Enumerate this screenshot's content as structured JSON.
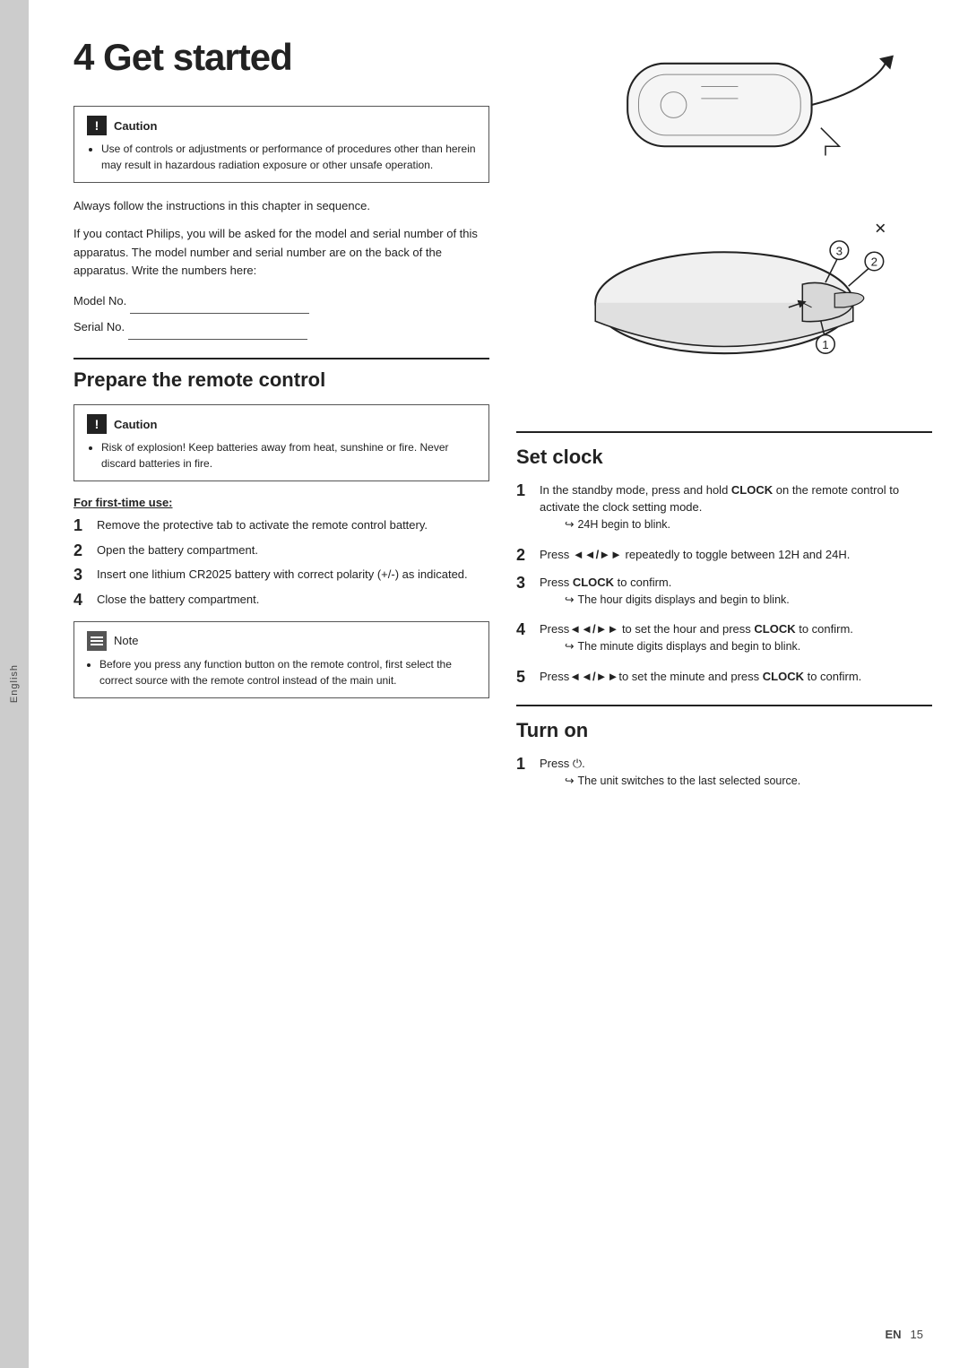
{
  "sidebar": {
    "label": "English"
  },
  "header": {
    "chapter": "4",
    "title": "Get started"
  },
  "caution1": {
    "title": "Caution",
    "icon_label": "!",
    "text": "Use of controls or adjustments or performance of procedures other than herein may result in hazardous radiation exposure or other unsafe operation."
  },
  "intro": {
    "para1": "Always follow the instructions in this chapter in sequence.",
    "para2": "If you contact Philips, you will be asked for the model and serial number of this apparatus. The model number and serial number are on the back of the apparatus. Write the numbers here:",
    "model_label": "Model No.",
    "serial_label": "Serial No."
  },
  "prepare": {
    "heading": "Prepare the remote control",
    "caution": {
      "title": "Caution",
      "icon_label": "!",
      "text": "Risk of explosion! Keep batteries away from heat, sunshine or fire. Never discard batteries in fire."
    },
    "first_use": {
      "heading": "For first-time use:",
      "steps": [
        "Remove the protective tab to activate the remote control battery.",
        "Open the battery compartment.",
        "Insert one lithium CR2025 battery with correct polarity (+/-) as indicated.",
        "Close the battery compartment."
      ]
    },
    "note": {
      "title": "Note",
      "text": "Before you press any function button on the remote control, first select the correct source with the remote control instead of the main unit."
    }
  },
  "set_clock": {
    "heading": "Set clock",
    "steps": [
      {
        "num": "1",
        "text": "In the standby mode, press and hold CLOCK on the remote control to activate the clock setting mode.",
        "arrow": "24H begin to blink."
      },
      {
        "num": "2",
        "text": "Press ◄◄/►► repeatedly to toggle between 12H and 24H."
      },
      {
        "num": "3",
        "text": "Press CLOCK to confirm.",
        "arrow": "The hour digits displays and begin to blink."
      },
      {
        "num": "4",
        "text": "Press◄◄/►► to set the hour and press CLOCK to confirm.",
        "arrow": "The minute digits displays and begin to blink."
      },
      {
        "num": "5",
        "text": "Press◄◄/►►to set the minute and press CLOCK to confirm."
      }
    ]
  },
  "turn_on": {
    "heading": "Turn on",
    "steps": [
      {
        "num": "1",
        "text": "Press ⏻.",
        "arrow": "The unit switches to the last selected source."
      }
    ]
  },
  "footer": {
    "en": "EN",
    "page": "15"
  }
}
